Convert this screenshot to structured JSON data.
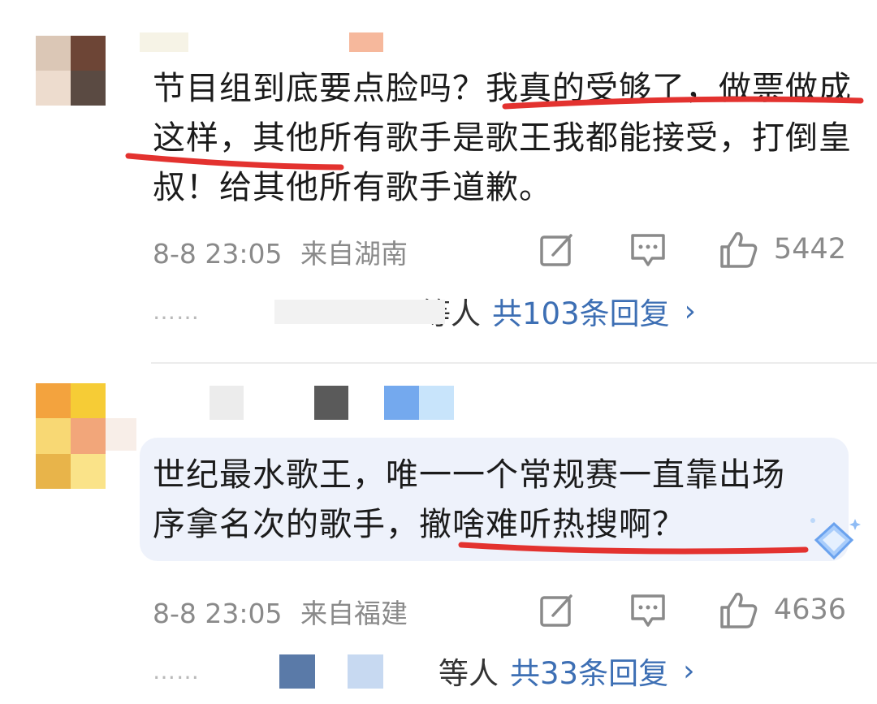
{
  "comments": [
    {
      "text": "节目组到底要点脸吗？我真的受够了，做票做成这样，其他所有歌手是歌王我都能接受，打倒皇叔！给其他所有歌手道歉。",
      "time": "8-8 23:05",
      "location": "来自湖南",
      "likes": "5442",
      "reply_dots": "……",
      "reply_suffix": "等人",
      "reply_link": "共103条回复",
      "chevron": "›"
    },
    {
      "text": "世纪最水歌王，唯一一个常规赛一直靠出场序拿名次的歌手，撤啥难听热搜啊？",
      "time": "8-8 23:05",
      "location": "来自福建",
      "likes": "4636",
      "reply_dots": "……",
      "reply_suffix": "等人",
      "reply_link": "共33条回复",
      "chevron": "›"
    }
  ],
  "icons": {
    "edit": "edit-icon",
    "comment": "comment-icon",
    "like": "thumbs-up-icon",
    "badge": "diamond-badge-icon"
  },
  "colors": {
    "underline": "#e3322f",
    "link": "#3d6fb4",
    "meta": "#8a8a8a",
    "bubble": "#eef2fb"
  }
}
